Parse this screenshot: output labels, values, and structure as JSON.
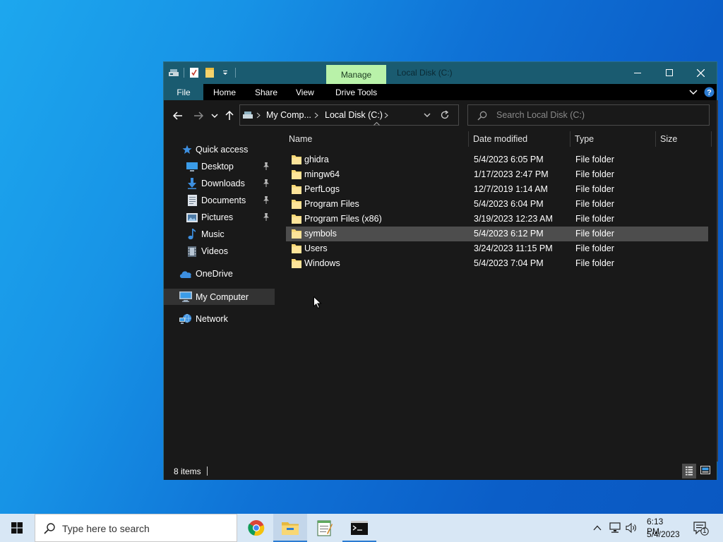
{
  "window": {
    "title": "Local Disk (C:)",
    "manage_tab": "Manage",
    "accent_color": "#1a5b70",
    "manage_color": "#b9f2a9"
  },
  "ribbon": {
    "tabs": [
      "File",
      "Home",
      "Share",
      "View",
      "Drive Tools"
    ]
  },
  "address": {
    "segments": [
      "My Comp...",
      "Local Disk (C:)"
    ],
    "search_placeholder": "Search Local Disk (C:)"
  },
  "nav": {
    "quick_access": "Quick access",
    "pinned": [
      {
        "label": "Desktop",
        "icon": "desktop-icon",
        "pinned": true
      },
      {
        "label": "Downloads",
        "icon": "downloads-icon",
        "pinned": true
      },
      {
        "label": "Documents",
        "icon": "documents-icon",
        "pinned": true
      },
      {
        "label": "Pictures",
        "icon": "pictures-icon",
        "pinned": true
      },
      {
        "label": "Music",
        "icon": "music-icon",
        "pinned": false
      },
      {
        "label": "Videos",
        "icon": "videos-icon",
        "pinned": false
      }
    ],
    "onedrive": "OneDrive",
    "my_computer": "My Computer",
    "network": "Network"
  },
  "columns": {
    "name": "Name",
    "date": "Date modified",
    "type": "Type",
    "size": "Size"
  },
  "files": [
    {
      "name": "ghidra",
      "date": "5/4/2023 6:05 PM",
      "type": "File folder"
    },
    {
      "name": "mingw64",
      "date": "1/17/2023 2:47 PM",
      "type": "File folder"
    },
    {
      "name": "PerfLogs",
      "date": "12/7/2019 1:14 AM",
      "type": "File folder"
    },
    {
      "name": "Program Files",
      "date": "5/4/2023 6:04 PM",
      "type": "File folder"
    },
    {
      "name": "Program Files (x86)",
      "date": "3/19/2023 12:23 AM",
      "type": "File folder"
    },
    {
      "name": "symbols",
      "date": "5/4/2023 6:12 PM",
      "type": "File folder",
      "hovered": true
    },
    {
      "name": "Users",
      "date": "3/24/2023 11:15 PM",
      "type": "File folder"
    },
    {
      "name": "Windows",
      "date": "5/4/2023 7:04 PM",
      "type": "File folder"
    }
  ],
  "status": {
    "items": "8 items"
  },
  "taskbar": {
    "search_placeholder": "Type here to search",
    "apps": [
      "chrome-icon",
      "file-explorer-icon",
      "notepad-icon",
      "terminal-icon"
    ],
    "time": "6:13 PM",
    "date": "5/4/2023",
    "notifications": "1"
  }
}
